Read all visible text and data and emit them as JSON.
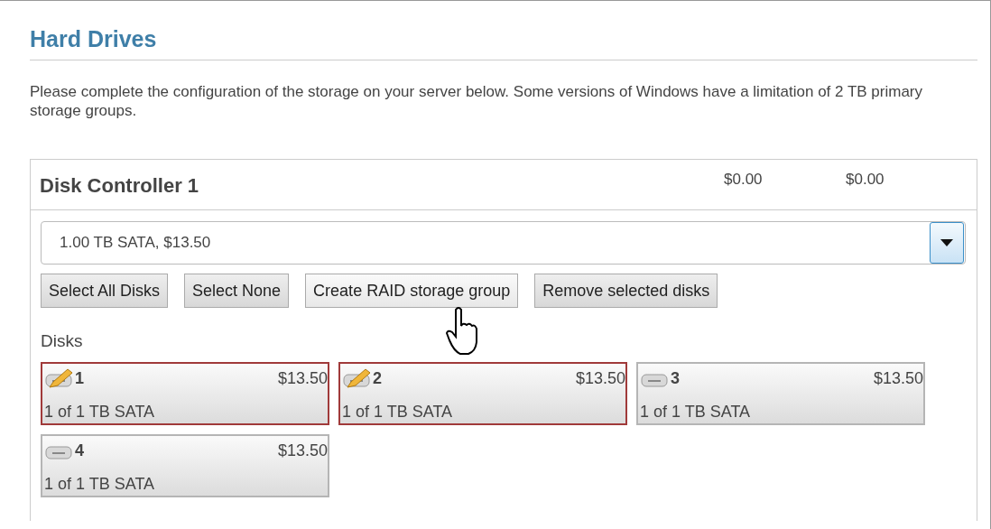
{
  "title": "Hard Drives",
  "description": "Please complete the configuration of the storage on your server below. Some versions of Windows have a limitation of 2 TB primary storage groups.",
  "controller": {
    "name": "Disk Controller 1",
    "prices": [
      "$0.00",
      "$0.00"
    ],
    "dropdown": {
      "value": "1.00 TB SATA, $13.50"
    },
    "buttons": [
      "Select All Disks",
      "Select None",
      "Create RAID storage group",
      "Remove selected disks"
    ],
    "disks_label": "Disks",
    "disks": [
      {
        "number": "1",
        "price": "$13.50",
        "description": "1 of 1 TB SATA",
        "selected": true
      },
      {
        "number": "2",
        "price": "$13.50",
        "description": "1 of 1 TB SATA",
        "selected": true
      },
      {
        "number": "3",
        "price": "$13.50",
        "description": "1 of 1 TB SATA",
        "selected": false
      },
      {
        "number": "4",
        "price": "$13.50",
        "description": "1 of 1 TB SATA",
        "selected": false
      }
    ]
  }
}
